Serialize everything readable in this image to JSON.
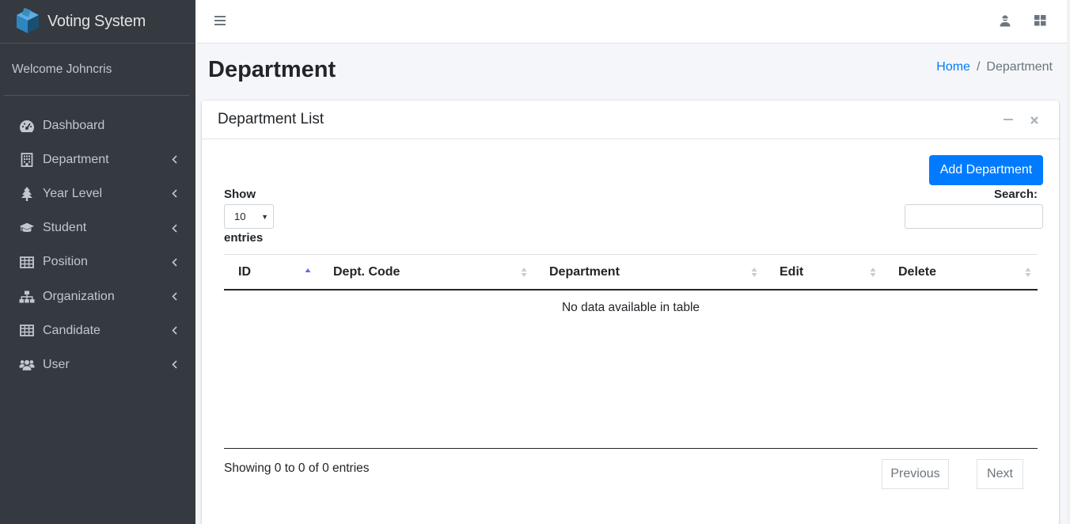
{
  "app": {
    "brand": "Voting System",
    "welcome": "Welcome Johncris"
  },
  "sidebar": {
    "items": [
      {
        "label": "Dashboard",
        "icon": "tachometer-icon",
        "has_chevron": false
      },
      {
        "label": "Department",
        "icon": "building-icon",
        "has_chevron": true
      },
      {
        "label": "Year Level",
        "icon": "tree-icon",
        "has_chevron": true
      },
      {
        "label": "Student",
        "icon": "graduation-cap-icon",
        "has_chevron": true
      },
      {
        "label": "Position",
        "icon": "table-icon",
        "has_chevron": true
      },
      {
        "label": "Organization",
        "icon": "sitemap-icon",
        "has_chevron": true
      },
      {
        "label": "Candidate",
        "icon": "table-icon",
        "has_chevron": true
      },
      {
        "label": "User",
        "icon": "users-icon",
        "has_chevron": true
      }
    ]
  },
  "header": {
    "title": "Department",
    "breadcrumb": {
      "home": "Home",
      "separator": "/",
      "current": "Department"
    }
  },
  "card": {
    "title": "Department List",
    "add_button": "Add Department",
    "show_label": "Show",
    "page_length": "10",
    "entries_label": "entries",
    "search_label": "Search:",
    "search_value": ""
  },
  "table": {
    "columns": [
      "ID",
      "Dept. Code",
      "Department",
      "Edit",
      "Delete"
    ],
    "sorted_column": "ID",
    "empty_message": "No data available in table"
  },
  "footer": {
    "info": "Showing 0 to 0 of 0 entries",
    "previous": "Previous",
    "next": "Next"
  },
  "colors": {
    "sidebar_bg": "#343a40",
    "primary": "#007bff",
    "content_bg": "#f4f6f9",
    "brand_logo": "#3c8dbc"
  }
}
